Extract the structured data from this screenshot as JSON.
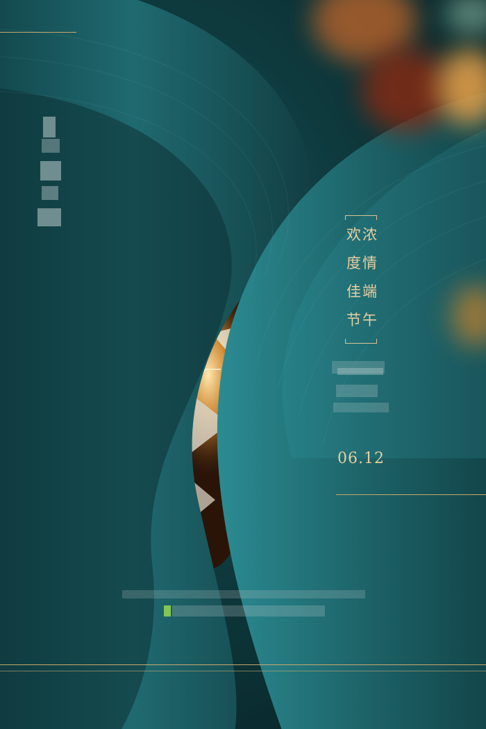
{
  "poster": {
    "headline_rows": [
      "欢浓",
      "度情",
      "佳端",
      "节午"
    ],
    "date": "06.12"
  },
  "colors": {
    "background": "#0e3a3e",
    "ring_teal": "#2a7f86",
    "gold_text": "#e8cf9e",
    "gold_line": "#c9a96e",
    "bokeh_orange": "#d86a1e"
  },
  "decor": {
    "pixelated_logo_icon": "mosaic-censored-logo",
    "pixelated_brand_icon": "mosaic-censored-brand",
    "pixelated_footer_icon": "mosaic-censored-footer"
  }
}
